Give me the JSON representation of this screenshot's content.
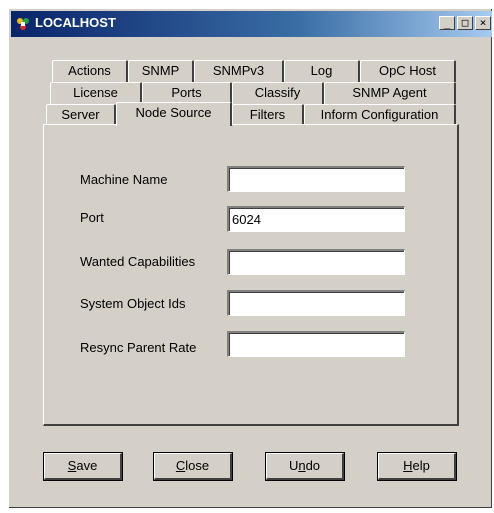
{
  "window": {
    "title": "LOCALHOST"
  },
  "titlebar_buttons": {
    "minimize": "_",
    "maximize": "□",
    "close": "×"
  },
  "tabs": {
    "row1": [
      "Actions",
      "SNMP",
      "SNMPv3",
      "Log",
      "OpC Host"
    ],
    "row2": [
      "License",
      "Ports",
      "Classify",
      "SNMP Agent"
    ],
    "row3": [
      "Server",
      "Node Source",
      "Filters",
      "Inform Configuration"
    ],
    "active": "Node Source"
  },
  "form": {
    "machine_name": {
      "label": "Machine Name",
      "value": ""
    },
    "port": {
      "label": "Port",
      "value": "6024"
    },
    "wanted_capabilities": {
      "label": "Wanted Capabilities",
      "value": ""
    },
    "system_object_ids": {
      "label": "System Object Ids",
      "value": ""
    },
    "resync_parent_rate": {
      "label": "Resync Parent Rate",
      "value": ""
    }
  },
  "buttons": {
    "save": {
      "first": "S",
      "rest": "ave"
    },
    "close": {
      "first": "C",
      "rest": "lose"
    },
    "undo": {
      "first": "U",
      "mid": "n",
      "rest": "do"
    },
    "help": {
      "first": "H",
      "rest": "elp"
    }
  }
}
